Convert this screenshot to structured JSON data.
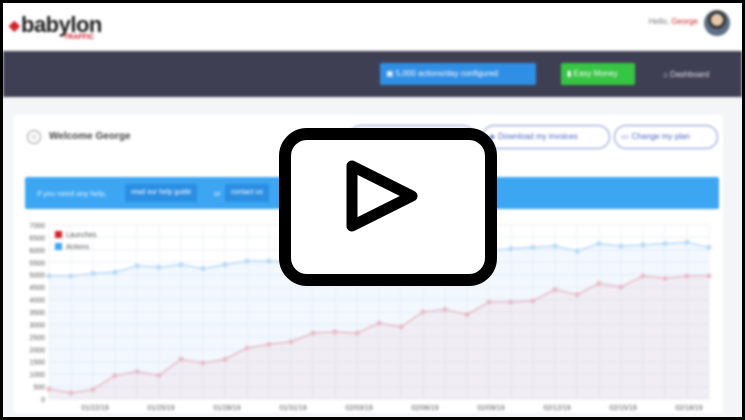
{
  "header": {
    "logo_word": "babylon",
    "logo_sub": "TRAFFIC",
    "hello_prefix": "Hello,",
    "user_name": "George"
  },
  "navbar": {
    "actions_button": "5,000 actions/day configured",
    "easy_money_button": "Easy Money",
    "dashboard_link": "Dashboard"
  },
  "card": {
    "welcome": "Welcome George",
    "download_invoices": "Download my invoices",
    "change_plan": "Change my plan"
  },
  "help": {
    "text": "If you need any help,",
    "guide_button": "read our help guide",
    "or": "or",
    "contact_button": "contact us"
  },
  "chart_data": {
    "type": "line",
    "ylim": [
      0,
      7000
    ],
    "yticks": [
      0,
      500,
      1000,
      1500,
      2000,
      2500,
      3000,
      3500,
      4000,
      4500,
      5000,
      5500,
      6000,
      6500,
      7000
    ],
    "xtick_labels": [
      "01/22/19",
      "01/25/19",
      "01/28/19",
      "01/31/19",
      "02/03/19",
      "02/06/19",
      "02/09/19",
      "02/12/19",
      "02/15/19",
      "02/18/19"
    ],
    "legend_position": "top-left",
    "series": [
      {
        "name": "Launches",
        "color": "#f2b8be",
        "values": [
          400,
          250,
          380,
          950,
          1100,
          950,
          1600,
          1450,
          1600,
          2050,
          2200,
          2300,
          2650,
          2700,
          2650,
          3050,
          2900,
          3500,
          3600,
          3400,
          3900,
          3900,
          3950,
          4400,
          4200,
          4650,
          4500,
          4950,
          4850,
          4950,
          4950
        ]
      },
      {
        "name": "Actions",
        "color": "#b9daf7",
        "values": [
          4950,
          4950,
          5050,
          5100,
          5350,
          5300,
          5400,
          5250,
          5400,
          5550,
          5550,
          5500,
          5600,
          5650,
          5700,
          5650,
          5750,
          5800,
          5900,
          5950,
          5950,
          6050,
          6100,
          6150,
          5950,
          6250,
          6150,
          6200,
          6250,
          6300,
          6100
        ]
      }
    ]
  }
}
